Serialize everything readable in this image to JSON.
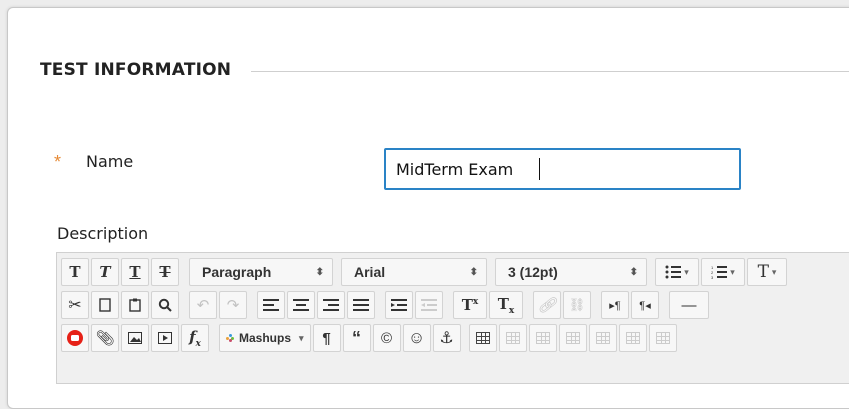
{
  "section": {
    "title": "TEST INFORMATION"
  },
  "name_field": {
    "label": "Name",
    "required_mark": "*",
    "value": "MidTerm Exam"
  },
  "description": {
    "label": "Description"
  },
  "toolbar": {
    "format_bold": "T",
    "format_italic": "T",
    "format_underline": "T",
    "format_strike": "T",
    "paragraph_select": "Paragraph",
    "font_select": "Arial",
    "size_select": "3 (12pt)",
    "text_color": "T",
    "superscript": "T",
    "subscript": "T",
    "superscript_mark": "x",
    "subscript_mark": "x",
    "mashups_label": "Mashups",
    "paragraph_mark": "¶",
    "quote_mark": "“",
    "copyright_mark": "©",
    "function_mark": "f",
    "function_sub": "x"
  },
  "colors": {
    "accent": "#2a83c6",
    "required": "#e68a35",
    "youtube": "#e62117"
  }
}
